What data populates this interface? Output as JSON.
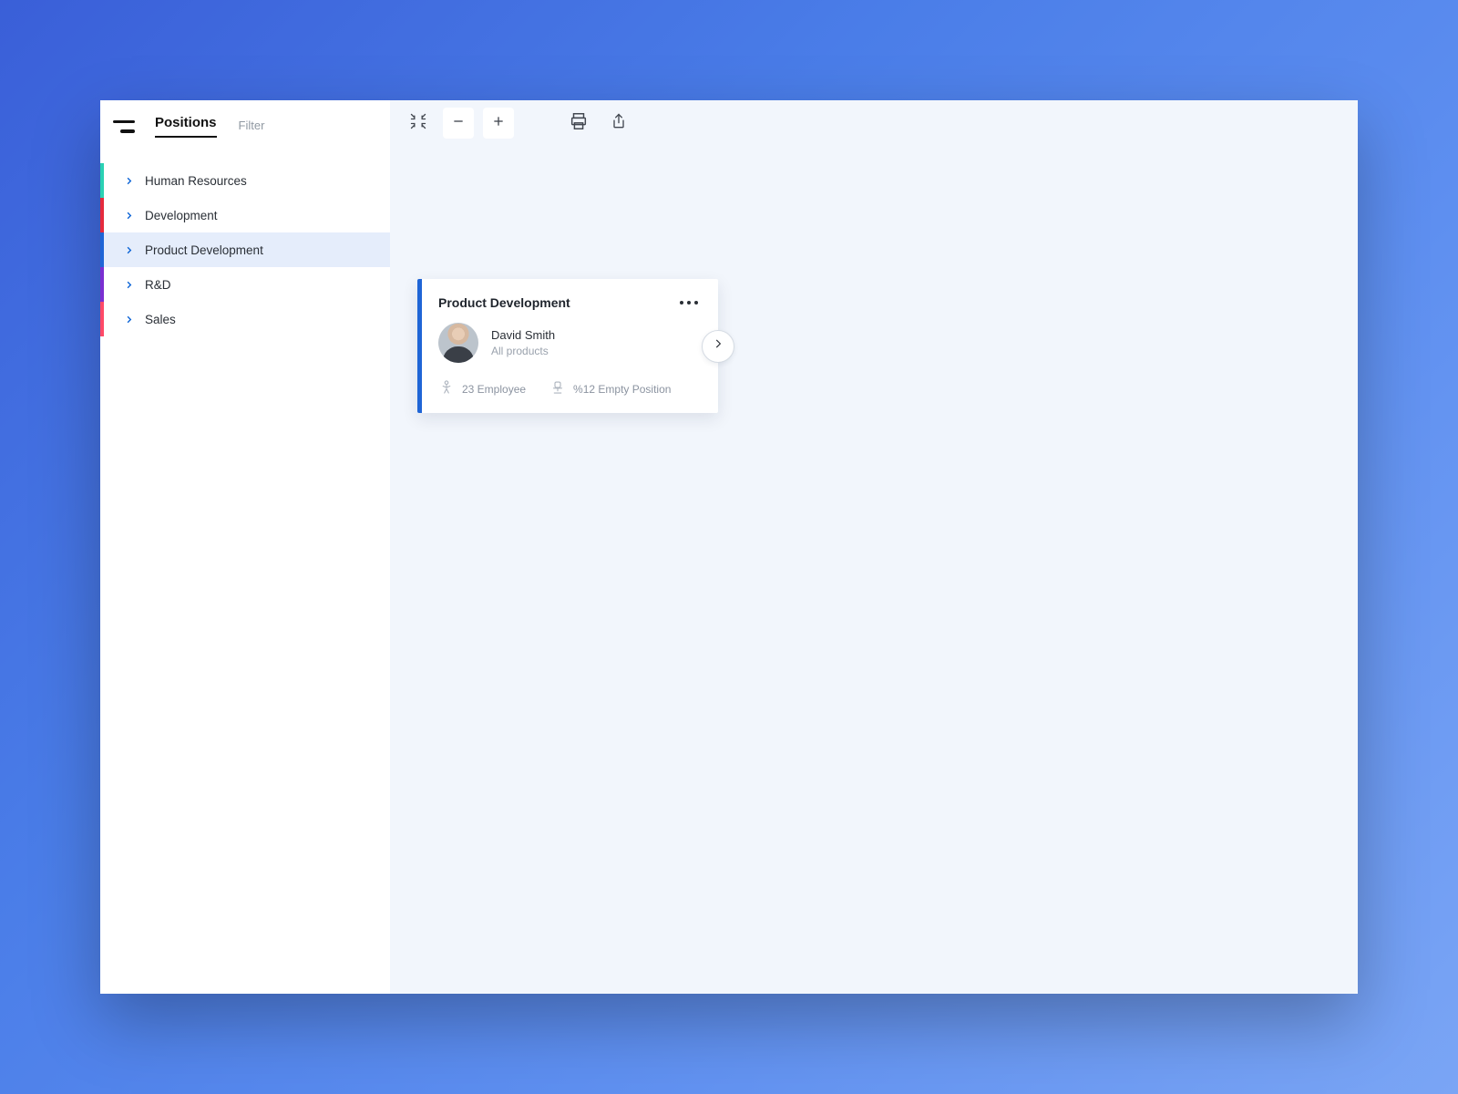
{
  "sidebar": {
    "tabs": {
      "primary": "Positions",
      "secondary": "Filter"
    },
    "items": [
      {
        "label": "Human Resources",
        "marker_color": "#2ad1b3",
        "active": false
      },
      {
        "label": "Development",
        "marker_color": "#e52a3d",
        "active": false
      },
      {
        "label": "Product Development",
        "marker_color": "#1f65d6",
        "active": true
      },
      {
        "label": "R&D",
        "marker_color": "#7a2fd1",
        "active": false
      },
      {
        "label": "Sales",
        "marker_color": "#ff4a68",
        "active": false
      }
    ]
  },
  "card": {
    "title": "Product Development",
    "lead_name": "David Smith",
    "lead_subtitle": "All products",
    "employee_stat": "23 Employee",
    "empty_stat": "%12 Empty Position",
    "accent_color": "#1f65d6"
  }
}
